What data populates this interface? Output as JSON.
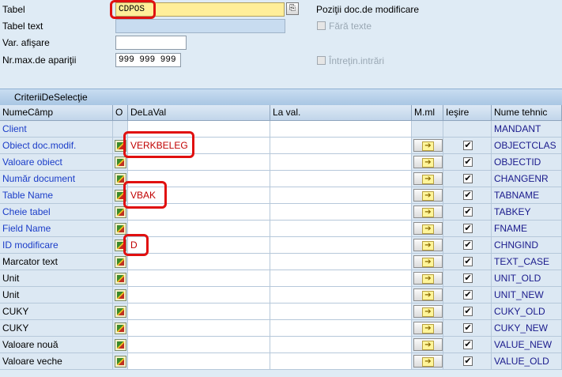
{
  "form": {
    "tabel_label": "Tabel",
    "tabel_value": "CDPOS",
    "tabel_text_label": "Tabel text",
    "tabel_text_value": "",
    "var_afisare_label": "Var. afişare",
    "var_afisare_value": "",
    "nrmax_label": "Nr.max.de apariţii",
    "nrmax_value": "999 999 999",
    "pozitii_label": "Poziţii doc.de modificare",
    "fara_texte_label": "Fără texte",
    "intretin_label": "Întreţin.intrări"
  },
  "table": {
    "section_title": "CriteriiDeSelecţie",
    "headers": [
      "NumeCâmp",
      "O",
      "DeLaVal",
      "La val.",
      "M.ml",
      "Ieşire",
      "Nume tehnic"
    ],
    "rows": [
      {
        "name": "Client",
        "from": "",
        "tech": "MANDANT",
        "link": true,
        "has_controls": false
      },
      {
        "name": "Obiect doc.modif.",
        "from": "VERKBELEG",
        "tech": "OBJECTCLAS",
        "link": true,
        "has_controls": true
      },
      {
        "name": "Valoare obiect",
        "from": "",
        "tech": "OBJECTID",
        "link": true,
        "has_controls": true
      },
      {
        "name": "Număr document",
        "from": "",
        "tech": "CHANGENR",
        "link": true,
        "has_controls": true
      },
      {
        "name": "Table Name",
        "from": "VBAK",
        "tech": "TABNAME",
        "link": true,
        "has_controls": true
      },
      {
        "name": "Cheie tabel",
        "from": "",
        "tech": "TABKEY",
        "link": true,
        "has_controls": true
      },
      {
        "name": "Field Name",
        "from": "",
        "tech": "FNAME",
        "link": true,
        "has_controls": true
      },
      {
        "name": "ID modificare",
        "from": "D",
        "tech": "CHNGIND",
        "link": true,
        "has_controls": true
      },
      {
        "name": "Marcator text",
        "from": "",
        "tech": "TEXT_CASE",
        "link": false,
        "has_controls": true
      },
      {
        "name": "Unit",
        "from": "",
        "tech": "UNIT_OLD",
        "link": false,
        "has_controls": true
      },
      {
        "name": "Unit",
        "from": "",
        "tech": "UNIT_NEW",
        "link": false,
        "has_controls": true
      },
      {
        "name": "CUKY",
        "from": "",
        "tech": "CUKY_OLD",
        "link": false,
        "has_controls": true
      },
      {
        "name": "CUKY",
        "from": "",
        "tech": "CUKY_NEW",
        "link": false,
        "has_controls": true
      },
      {
        "name": "Valoare nouă",
        "from": "",
        "tech": "VALUE_NEW",
        "link": false,
        "has_controls": true
      },
      {
        "name": "Valoare veche",
        "from": "",
        "tech": "VALUE_OLD",
        "link": false,
        "has_controls": true
      }
    ]
  },
  "icons": {
    "multiple_selection": "arrow-right-icon",
    "output": "checkmark-icon",
    "option": "selection-option-icon"
  },
  "colors": {
    "link": "#1a3cc8",
    "value_red": "#c00000",
    "highlight": "#e01010"
  }
}
